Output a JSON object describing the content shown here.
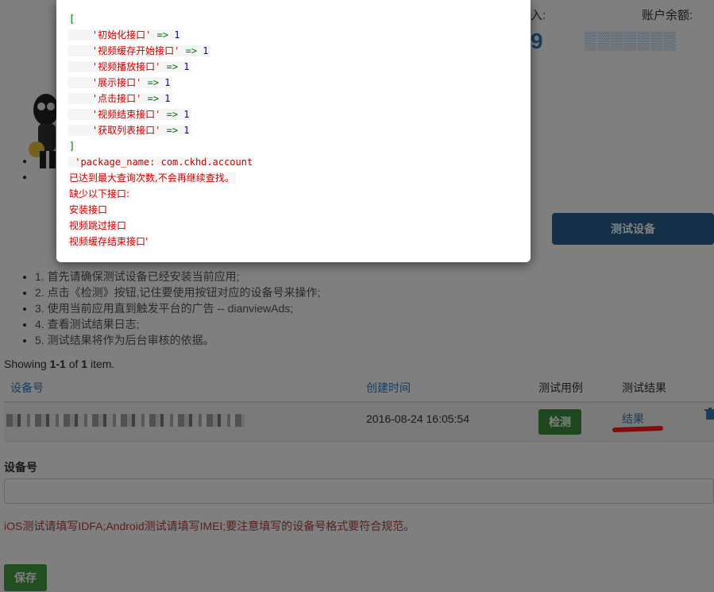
{
  "header": {
    "left_label_partial": "入:",
    "balance_label": "账户余额:",
    "left_number_partial": "9",
    "balance_value_masked": "▒▒▒▒▒▒▒"
  },
  "buttons": {
    "test_device": "测试设备",
    "detect": "检测",
    "save": "保存"
  },
  "steps": [
    "1. 首先请确保测试设备已经安装当前应用;",
    "2. 点击《检测》按钮,记住要使用按钮对应的设备号来操作;",
    "3. 使用当前应用直到触发平台的广告 -- dianviewAds;",
    "4. 查看测试结果日志;",
    "5. 测试结果将作为后台审核的依据。"
  ],
  "summary": {
    "prefix": "Showing ",
    "range": "1-1",
    "of": " of ",
    "total": "1",
    "suffix": " item."
  },
  "table": {
    "headers": [
      "设备号",
      "创建时间",
      "测试用例",
      "测试结果"
    ],
    "rows": [
      {
        "device": "",
        "created": "2016-08-24 16:05:54",
        "action": "检测",
        "result": "结果"
      }
    ]
  },
  "form": {
    "device_label": "设备号",
    "device_value": "",
    "hint": "iOS测试请填写IDFA;Android测试请填写IMEI;要注意填写的设备号格式要符合规范。"
  },
  "modal": {
    "open_bracket": "[",
    "entries": [
      {
        "key": "'初始化接口'",
        "value": "1"
      },
      {
        "key": "'视频缓存开始接口'",
        "value": "1"
      },
      {
        "key": "'视频播放接口'",
        "value": "1"
      },
      {
        "key": "'展示接口'",
        "value": "1"
      },
      {
        "key": "'点击接口'",
        "value": "1"
      },
      {
        "key": "'视频结束接口'",
        "value": "1"
      },
      {
        "key": "'获取列表接口'",
        "value": "1"
      }
    ],
    "arrow": "=>",
    "close_bracket": "]",
    "messages": [
      " 'package_name: com.ckhd.account",
      "已达到最大查询次数,不会再继续查找。",
      "缺少以下接口:",
      "安装接口",
      "视频跳过接口",
      "视频缓存结束接口'"
    ]
  },
  "colors": {
    "primary_button": "#286090",
    "success_button": "#449d44",
    "link": "#337ab7",
    "error_text": "#a94442",
    "annotation": "#ff1a1a"
  }
}
